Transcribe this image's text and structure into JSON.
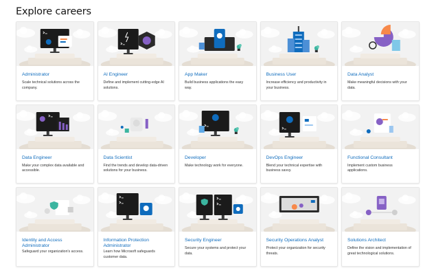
{
  "page": {
    "title": "Explore careers"
  },
  "careers": [
    {
      "title": "Administrator",
      "description": "Scale technical solutions across the company.",
      "icon": "admin-illustration-icon"
    },
    {
      "title": "AI Engineer",
      "description": "Define and implement cutting-edge AI solutions.",
      "icon": "ai-illustration-icon"
    },
    {
      "title": "App Maker",
      "description": "Build business applications the easy way.",
      "icon": "app-maker-illustration-icon"
    },
    {
      "title": "Business User",
      "description": "Increase efficiency and productivity in your business.",
      "icon": "business-user-illustration-icon"
    },
    {
      "title": "Data Analyst",
      "description": "Make meaningful decisions with your data.",
      "icon": "data-analyst-illustration-icon"
    },
    {
      "title": "Data Engineer",
      "description": "Make your complex data available and accessible.",
      "icon": "data-engineer-illustration-icon"
    },
    {
      "title": "Data Scientist",
      "description": "Find the trends and develop data-driven solutions for your business.",
      "icon": "data-scientist-illustration-icon"
    },
    {
      "title": "Developer",
      "description": "Make technology work for everyone.",
      "icon": "developer-illustration-icon"
    },
    {
      "title": "DevOps Engineer",
      "description": "Blend your technical expertise with business savvy.",
      "icon": "devops-illustration-icon"
    },
    {
      "title": "Functional Consultant",
      "description": "Implement custom business applications.",
      "icon": "functional-consultant-illustration-icon"
    },
    {
      "title": "Identity and Access Administrator",
      "description": "Safeguard your organization's access.",
      "icon": "identity-access-illustration-icon"
    },
    {
      "title": "Information Protection Administrator",
      "description": "Learn how Microsoft safeguards customer data.",
      "icon": "information-protection-illustration-icon"
    },
    {
      "title": "Security Engineer",
      "description": "Secure your systems and protect your data.",
      "icon": "security-engineer-illustration-icon"
    },
    {
      "title": "Security Operations Analyst",
      "description": "Protect your organization for security threats.",
      "icon": "security-operations-illustration-icon"
    },
    {
      "title": "Solutions Architect",
      "description": "Define the vision and implementation of great technological solutions.",
      "icon": "solutions-architect-illustration-icon"
    }
  ],
  "colors": {
    "link": "#0f6cbd",
    "thumb_bg": "#f2f2f2",
    "pedestal": "#e9e1d6",
    "monitor": "#1b1b1b",
    "accent_blue": "#0f6cbd",
    "accent_teal": "#3bb5a0",
    "accent_purple": "#8661c5",
    "accent_orange": "#f7894a"
  }
}
